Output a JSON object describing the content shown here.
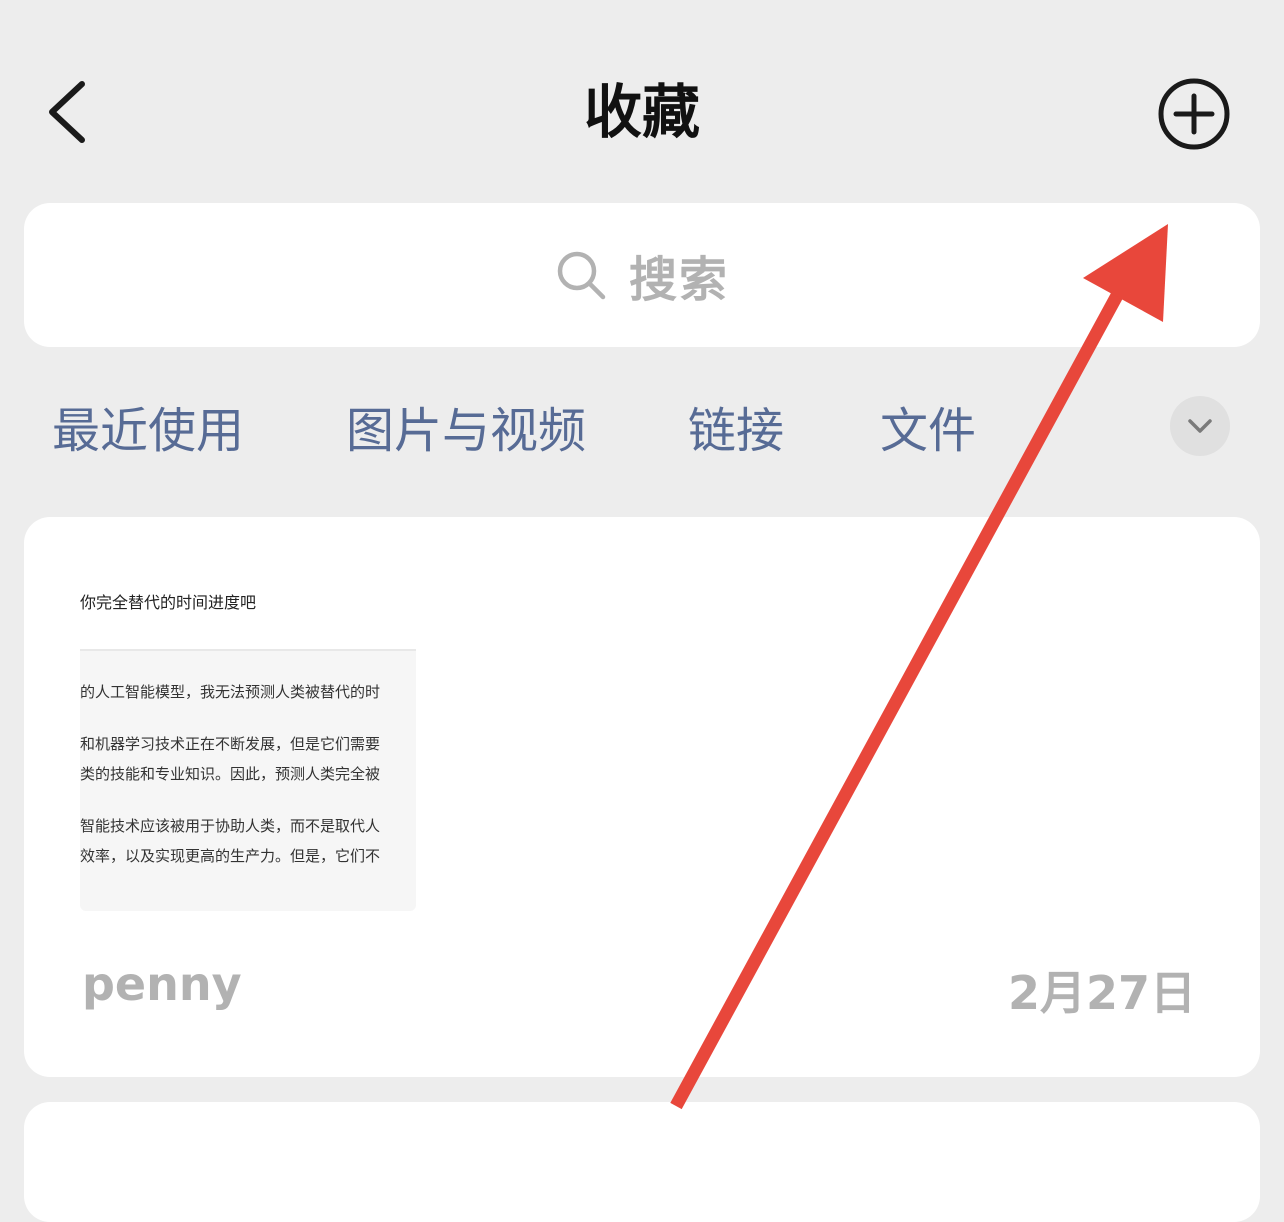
{
  "header": {
    "title": "收藏",
    "back_icon": "chevron-left-icon",
    "add_icon": "plus-circle-icon"
  },
  "search": {
    "placeholder": "搜索",
    "icon": "search-icon"
  },
  "filters": {
    "tabs": [
      {
        "label": "最近使用"
      },
      {
        "label": "图片与视频"
      },
      {
        "label": "链接"
      },
      {
        "label": "文件"
      }
    ],
    "expand_icon": "chevron-down-icon"
  },
  "favorites": [
    {
      "thumbnail": {
        "title": "你完全替代的时间进度吧",
        "lines": [
          "的人工智能模型，我无法预测人类被替代的时",
          "和机器学习技术正在不断发展，但是它们需要",
          "类的技能和专业知识。因此，预测人类完全被",
          "智能技术应该被用于协助人类，而不是取代人",
          "效率，以及实现更高的生产力。但是，它们不"
        ]
      },
      "author": "penny",
      "date": "2月27日"
    }
  ],
  "colors": {
    "background": "#ededed",
    "card": "#ffffff",
    "link_blue": "#576b95",
    "muted_gray": "#b2b2b2",
    "annotation_red": "#e8473b"
  }
}
